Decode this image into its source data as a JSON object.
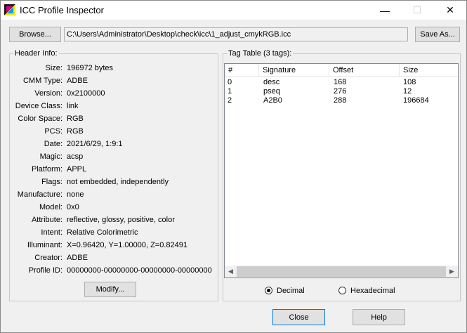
{
  "window": {
    "title": "ICC Profile Inspector"
  },
  "titlebar": {
    "minimize_glyph": "—",
    "maximize_glyph": "☐",
    "close_glyph": "✕"
  },
  "toolbar": {
    "browse_label": "Browse...",
    "path_value": "C:\\Users\\Administrator\\Desktop\\check\\icc\\1_adjust_cmykRGB.icc",
    "save_as_label": "Save As..."
  },
  "header_info": {
    "group_label": "Header Info:",
    "fields": [
      {
        "label": "Size:",
        "value": "196972 bytes"
      },
      {
        "label": "CMM Type:",
        "value": "ADBE"
      },
      {
        "label": "Version:",
        "value": "0x2100000"
      },
      {
        "label": "Device Class:",
        "value": "link"
      },
      {
        "label": "Color Space:",
        "value": "RGB"
      },
      {
        "label": "PCS:",
        "value": "RGB"
      },
      {
        "label": "Date:",
        "value": "2021/6/29, 1:9:1"
      },
      {
        "label": "Magic:",
        "value": "acsp"
      },
      {
        "label": "Platform:",
        "value": "APPL"
      },
      {
        "label": "Flags:",
        "value": "not embedded, independently"
      },
      {
        "label": "Manufacture:",
        "value": "none"
      },
      {
        "label": "Model:",
        "value": "0x0"
      },
      {
        "label": "Attribute:",
        "value": "reflective, glossy, positive, color"
      },
      {
        "label": "Intent:",
        "value": "Relative Colorimetric"
      },
      {
        "label": "Illuminant:",
        "value": "X=0.96420, Y=1.00000, Z=0.82491"
      },
      {
        "label": "Creator:",
        "value": "ADBE"
      },
      {
        "label": "Profile ID:",
        "value": "00000000-00000000-00000000-00000000"
      }
    ],
    "modify_label": "Modify..."
  },
  "tag_table": {
    "group_label": "Tag Table (3 tags):",
    "columns": [
      "#",
      "Signature",
      "Offset",
      "Size"
    ],
    "rows": [
      [
        "0",
        "desc",
        "168",
        "108"
      ],
      [
        "1",
        "pseq",
        "276",
        "12"
      ],
      [
        "2",
        "A2B0",
        "288",
        "196684"
      ]
    ],
    "scroll_left_glyph": "◀",
    "scroll_right_glyph": "▶"
  },
  "number_format": {
    "decimal_label": "Decimal",
    "hex_label": "Hexadecimal",
    "selected": "Decimal"
  },
  "footer": {
    "close_label": "Close",
    "help_label": "Help"
  },
  "colors": {
    "focus_border": "#0078d7",
    "window_bg": "#f0f0f0",
    "button_bg": "#e1e1e1"
  }
}
